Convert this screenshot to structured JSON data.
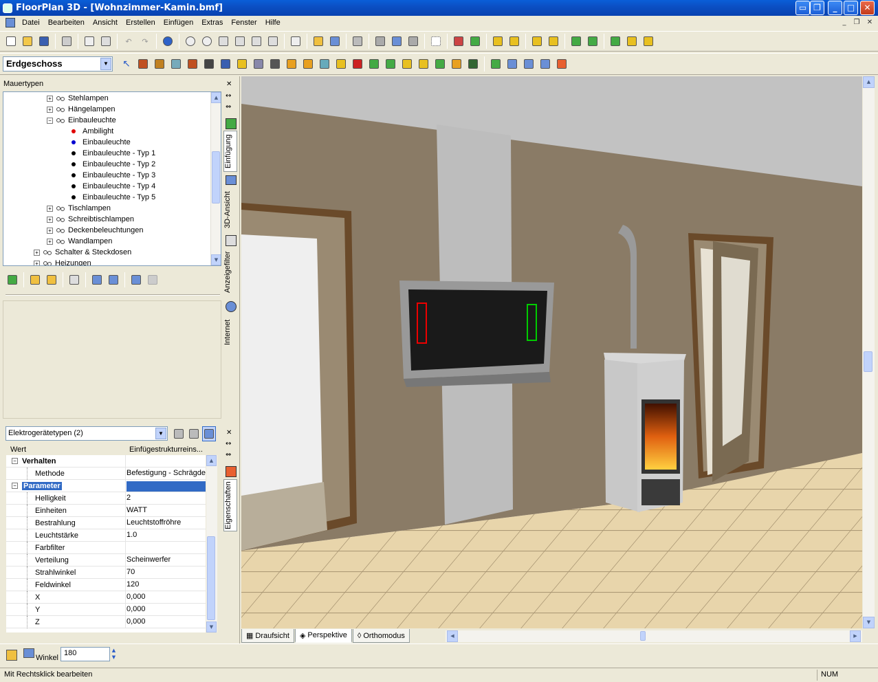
{
  "window": {
    "title": "FloorPlan 3D - [Wohnzimmer-Kamin.bmf]"
  },
  "menu": [
    "Datei",
    "Bearbeiten",
    "Ansicht",
    "Erstellen",
    "Einfügen",
    "Extras",
    "Fenster",
    "Hilfe"
  ],
  "floor_select": {
    "value": "Erdgeschoss"
  },
  "tree": {
    "title": "Mauertypen",
    "nodes": [
      {
        "label": "Stehlampen",
        "level": 2,
        "kind": "group",
        "state": "collapsed"
      },
      {
        "label": "Hängelampen",
        "level": 2,
        "kind": "group",
        "state": "collapsed"
      },
      {
        "label": "Einbauleuchte",
        "level": 2,
        "kind": "group",
        "state": "expanded"
      },
      {
        "label": "Ambilight",
        "level": 3,
        "kind": "item",
        "color": "#e00000"
      },
      {
        "label": "Einbauleuchte",
        "level": 3,
        "kind": "item",
        "color": "#0000d0"
      },
      {
        "label": "Einbauleuchte - Typ 1",
        "level": 3,
        "kind": "item",
        "color": "#000000"
      },
      {
        "label": "Einbauleuchte - Typ 2",
        "level": 3,
        "kind": "item",
        "color": "#000000"
      },
      {
        "label": "Einbauleuchte - Typ 3",
        "level": 3,
        "kind": "item",
        "color": "#000000"
      },
      {
        "label": "Einbauleuchte - Typ 4",
        "level": 3,
        "kind": "item",
        "color": "#000000"
      },
      {
        "label": "Einbauleuchte - Typ 5",
        "level": 3,
        "kind": "item",
        "color": "#000000"
      },
      {
        "label": "Tischlampen",
        "level": 2,
        "kind": "group",
        "state": "collapsed"
      },
      {
        "label": "Schreibtischlampen",
        "level": 2,
        "kind": "group",
        "state": "collapsed"
      },
      {
        "label": "Deckenbeleuchtungen",
        "level": 2,
        "kind": "group",
        "state": "collapsed"
      },
      {
        "label": "Wandlampen",
        "level": 2,
        "kind": "group",
        "state": "collapsed"
      },
      {
        "label": "Schalter & Steckdosen",
        "level": 1,
        "kind": "group",
        "state": "collapsed"
      },
      {
        "label": "Heizungen",
        "level": 1,
        "kind": "group",
        "state": "collapsed"
      }
    ]
  },
  "side_tabs": {
    "top": [
      "Einfügung",
      "3D-Ansicht",
      "Anzeigefilter",
      "Internet"
    ],
    "bottom": [
      "Eigenschaften"
    ]
  },
  "properties": {
    "type_select": "Elektrogerätetypen (2)",
    "headers": {
      "name": "Wert",
      "value": "Einfügestrukturreins..."
    },
    "rows": [
      {
        "name": "Verhalten",
        "value": "",
        "category": true,
        "selected": false
      },
      {
        "name": "Methode",
        "value": "Befestigung - Schrägdec",
        "category": false
      },
      {
        "name": "Parameter",
        "value": "",
        "category": true,
        "selected": true
      },
      {
        "name": "Helligkeit",
        "value": "2",
        "category": false
      },
      {
        "name": "Einheiten",
        "value": "WATT",
        "category": false
      },
      {
        "name": "Bestrahlung",
        "value": "Leuchtstoffröhre",
        "category": false
      },
      {
        "name": "Leuchtstärke",
        "value": "1.0",
        "category": false
      },
      {
        "name": "Farbfilter",
        "value": "",
        "category": false
      },
      {
        "name": "Verteilung",
        "value": "Scheinwerfer",
        "category": false
      },
      {
        "name": "Strahlwinkel",
        "value": "70",
        "category": false
      },
      {
        "name": "Feldwinkel",
        "value": "120",
        "category": false
      },
      {
        "name": "X",
        "value": "0,000",
        "category": false
      },
      {
        "name": "Y",
        "value": "0,000",
        "category": false
      },
      {
        "name": "Z",
        "value": "0,000",
        "category": false
      }
    ]
  },
  "view_tabs": [
    {
      "label": "Draufsicht",
      "active": false
    },
    {
      "label": "Perspektive",
      "active": true
    },
    {
      "label": "Orthomodus",
      "active": false
    }
  ],
  "angle": {
    "label": "Winkel",
    "value": "180"
  },
  "status": {
    "text": "Mit Rechtsklick bearbeiten",
    "num": "NUM"
  },
  "colors": {
    "title_bar": "#0b4fc4",
    "selection": "#316ac5",
    "wall": "#8a7b66",
    "floor": "#e6d2a6"
  }
}
